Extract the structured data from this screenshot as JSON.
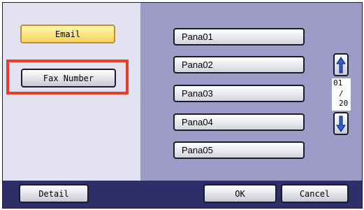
{
  "left_panel": {
    "email_label": "Email",
    "fax_number_label": "Fax Number"
  },
  "destinations": [
    "Pana01",
    "Pana02",
    "Pana03",
    "Pana04",
    "Pana05"
  ],
  "pagination": {
    "current": "01",
    "separator": "/",
    "total": "20"
  },
  "icons": {
    "up": "arrow-up-icon",
    "down": "arrow-down-icon"
  },
  "bottom_bar": {
    "detail_label": "Detail",
    "ok_label": "OK",
    "cancel_label": "Cancel"
  },
  "colors": {
    "highlight": "#ec3b2a",
    "selected_tab": "#f7d560",
    "arrow_blue": "#2f5fc8"
  }
}
